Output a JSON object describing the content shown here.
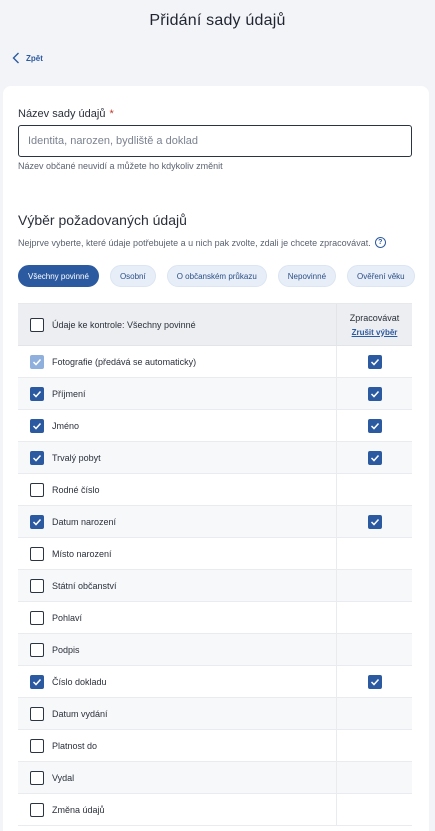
{
  "header": {
    "title": "Přidání sady údajů"
  },
  "back": {
    "label": "Zpět"
  },
  "form": {
    "name_label": "Název sady údajů",
    "required_mark": "*",
    "name_placeholder": "Identita, narozen, bydliště a doklad",
    "name_value": "",
    "name_hint": "Název občané neuvidí a můžete ho kdykoliv změnit"
  },
  "selection": {
    "title": "Výběr požadovaných údajů",
    "description": "Nejprve vyberte, které údaje potřebujete a u nich pak zvolte, zdali je chcete zpracovávat.",
    "help_icon": "?",
    "chips": [
      {
        "label": "Všechny povinné",
        "active": true
      },
      {
        "label": "Osobní",
        "active": false
      },
      {
        "label": "O občanském průkazu",
        "active": false
      },
      {
        "label": "Nepovinné",
        "active": false
      },
      {
        "label": "Ověření věku",
        "active": false
      }
    ]
  },
  "table": {
    "header_label": "Údaje ke kontrole: Všechny povinné",
    "process_header": "Zpracovávat",
    "clear_selection": "Zrušit výběr",
    "rows": [
      {
        "label": "Fotografie (předává se automaticky)",
        "checked": true,
        "disabled": true,
        "process": true
      },
      {
        "label": "Příjmení",
        "checked": true,
        "disabled": false,
        "process": true
      },
      {
        "label": "Jméno",
        "checked": true,
        "disabled": false,
        "process": true
      },
      {
        "label": "Trvalý pobyt",
        "checked": true,
        "disabled": false,
        "process": true
      },
      {
        "label": "Rodné číslo",
        "checked": false,
        "disabled": false,
        "process": null
      },
      {
        "label": "Datum narození",
        "checked": true,
        "disabled": false,
        "process": true
      },
      {
        "label": "Místo narození",
        "checked": false,
        "disabled": false,
        "process": null
      },
      {
        "label": "Státní občanství",
        "checked": false,
        "disabled": false,
        "process": null
      },
      {
        "label": "Pohlaví",
        "checked": false,
        "disabled": false,
        "process": null
      },
      {
        "label": "Podpis",
        "checked": false,
        "disabled": false,
        "process": null
      },
      {
        "label": "Číslo dokladu",
        "checked": true,
        "disabled": false,
        "process": true
      },
      {
        "label": "Datum vydání",
        "checked": false,
        "disabled": false,
        "process": null
      },
      {
        "label": "Platnost do",
        "checked": false,
        "disabled": false,
        "process": null
      },
      {
        "label": "Vydal",
        "checked": false,
        "disabled": false,
        "process": null
      },
      {
        "label": "Změna údajů",
        "checked": false,
        "disabled": false,
        "process": null
      }
    ]
  },
  "colors": {
    "accent": "#2c5aa0",
    "accent_disabled": "#8fb0dc",
    "background": "#f3f4f7"
  }
}
